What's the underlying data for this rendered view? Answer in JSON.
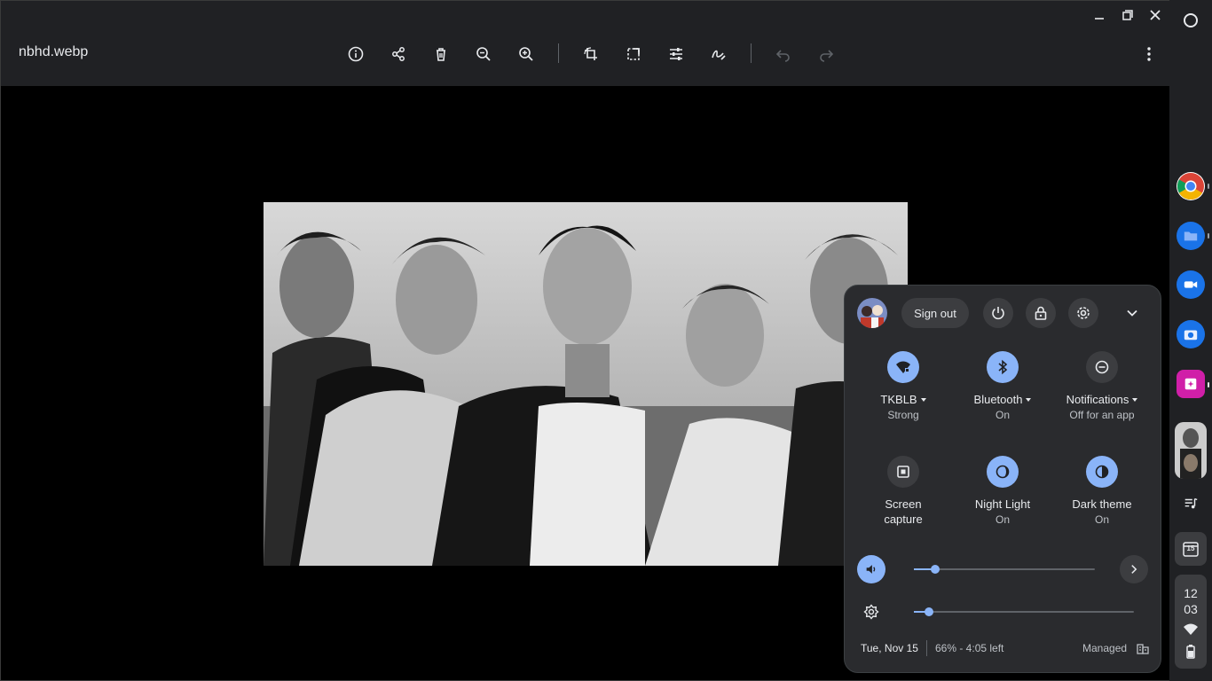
{
  "window": {
    "filename": "nbhd.webp"
  },
  "quick_settings": {
    "sign_out_label": "Sign out",
    "tiles": [
      {
        "label": "TKBLB",
        "sub": "Strong",
        "state": "on",
        "icon": "wifi-lock-icon",
        "has_menu": true
      },
      {
        "label": "Bluetooth",
        "sub": "On",
        "state": "on",
        "icon": "bluetooth-icon",
        "has_menu": true
      },
      {
        "label": "Notifications",
        "sub": "Off for an app",
        "state": "off",
        "icon": "do-not-disturb-icon",
        "has_menu": true
      },
      {
        "label": "Screen capture",
        "sub": "",
        "state": "off",
        "icon": "screen-capture-icon",
        "has_menu": false
      },
      {
        "label": "Night Light",
        "sub": "On",
        "state": "on",
        "icon": "night-light-icon",
        "has_menu": false
      },
      {
        "label": "Dark theme",
        "sub": "On",
        "state": "on",
        "icon": "dark-theme-icon",
        "has_menu": false
      }
    ],
    "volume_level": 0.12,
    "brightness_level": 0.07,
    "date": "Tue, Nov 15",
    "battery": "66% - 4:05 left",
    "managed": "Managed"
  },
  "shelf": {
    "time_hour": "12",
    "time_minute": "03",
    "calendar_day": "15"
  },
  "colors": {
    "accent": "#8ab4f8",
    "panel": "#2a2b2e",
    "toolbar": "#202124"
  }
}
